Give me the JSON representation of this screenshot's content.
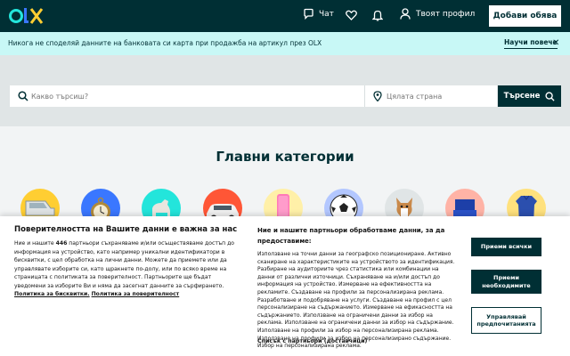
{
  "header": {
    "logo_text": "OLX",
    "chat_label": "Чат",
    "favorites_icon": "heart-icon",
    "notifications_icon": "bell-icon",
    "profile_label": "Твоят профил",
    "add_listing_label": "Добави обява"
  },
  "notice": {
    "text": "Никога не споделяй данните на банковата си карта при продажба на артикул през OLX",
    "more_label": "Научи повече",
    "close_symbol": "✕"
  },
  "search": {
    "placeholder": "Какво търсиш?",
    "location_placeholder": "Цялата страна",
    "button_label": "Търсене"
  },
  "categories": {
    "title": "Главни категории",
    "items": [
      {
        "icon": "car-door-icon",
        "color": "#ffce32"
      },
      {
        "icon": "pocket-watch-icon",
        "color": "#3a77ff"
      },
      {
        "icon": "horse-icon",
        "color": "#23e5db"
      },
      {
        "icon": "car-icon",
        "color": "#ff5636"
      },
      {
        "icon": "phone-icon",
        "color": "#fff0a8"
      },
      {
        "icon": "football-icon",
        "color": "#b3c7ff"
      },
      {
        "icon": "dog-icon",
        "color": "#e0e5e6"
      },
      {
        "icon": "chair-icon",
        "color": "#ffb3a6"
      },
      {
        "icon": "dress-icon",
        "color": "#ffe17d"
      }
    ]
  },
  "consent": {
    "title": "Поверителността на Вашите данни е важна за нас",
    "body_pre": "Ние и нашите ",
    "partner_count": "446",
    "body_post": " партньори съхраняваме и/или осъществяваме достъп до информация на устройство, като например уникални идентификатори в бисквитки, с цел обработка на лични данни. Можете да приемете или да управлявате изборите си, като щракнете по-долу, или по всяко време на страницата с политиката за поверителност. Партньорите ще бъдат уведомени за изборите Ви и няма да засегнат данните за сърфирането.",
    "cookies_link": "Политика за бисквитки.",
    "privacy_link": "Политика за поверителност",
    "purposes_heading": "Ние и нашите партньори обработваме данни, за да предоставиме:",
    "purposes_text": "Използване на точни данни за географско позициониране. Активно сканиране на характеристиките на устройството за идентификация. Разбиране на аудиториите чрез статистика или комбинации на данни от различни източници. Съхраняване на и/или достъп до информация на устройство. Измерване на ефективността на рекламите. Създаване на профили за персонализирана реклама. Разработване и подобряване на услуги. Създаване на профил с цел персонализиране на съдържанието. Измерване на ефикасността на съдържанието. Използване на ограничени данни за избор на реклама. Използване на ограничени данни за избор на съдържание. Използване на профили за избор на персонализирана реклама. Използване на профили за избор на персонализирано съдържание. Избор на персонализирана реклама.",
    "partners_link": "Списък с партньори (доставчици)",
    "accept_all_label": "Приеми всички",
    "accept_necessary_label": "Приеми необходимите",
    "manage_label": "Управлявай предпочитанията"
  }
}
